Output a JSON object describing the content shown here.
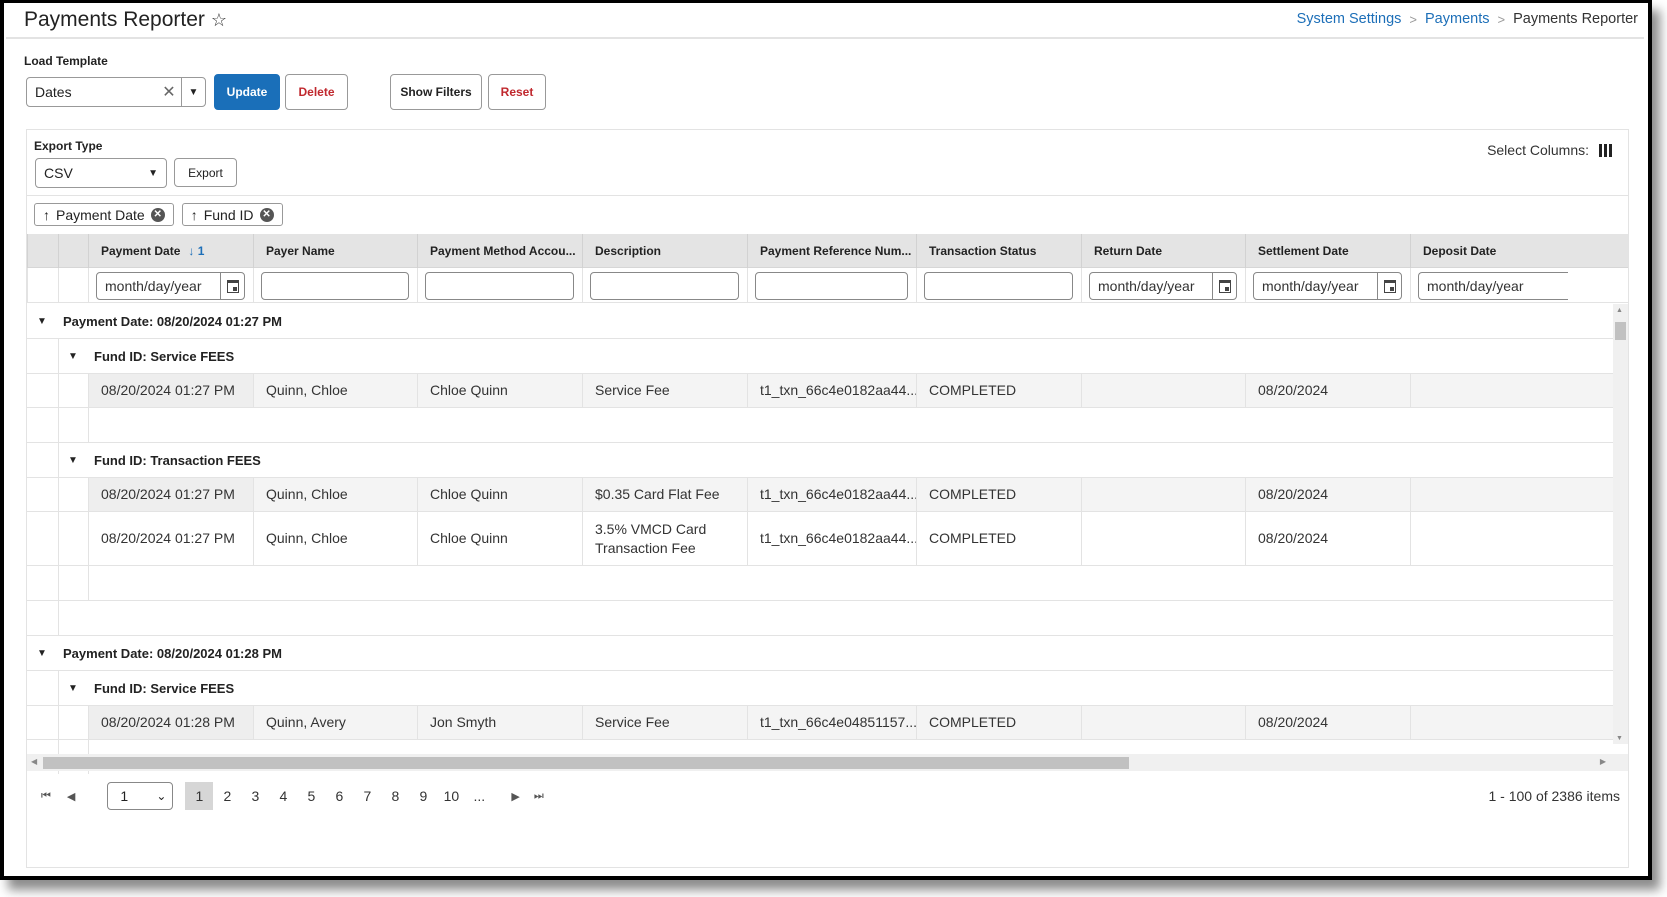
{
  "header": {
    "title": "Payments Reporter",
    "breadcrumb": [
      "System Settings",
      "Payments",
      "Payments Reporter"
    ]
  },
  "template": {
    "label": "Load Template",
    "value": "Dates",
    "update_label": "Update",
    "delete_label": "Delete",
    "show_filters_label": "Show Filters",
    "reset_label": "Reset"
  },
  "export": {
    "label": "Export Type",
    "value": "CSV",
    "button_label": "Export",
    "select_columns_label": "Select Columns:"
  },
  "group_chips": [
    "Payment Date",
    "Fund ID"
  ],
  "columns": [
    {
      "label": "Payment Date",
      "sort": "1",
      "filter": "month/day/year",
      "date": true
    },
    {
      "label": "Payer Name",
      "filter": ""
    },
    {
      "label": "Payment Method Accou...",
      "filter": ""
    },
    {
      "label": "Description",
      "filter": ""
    },
    {
      "label": "Payment Reference Num...",
      "filter": ""
    },
    {
      "label": "Transaction Status",
      "filter": ""
    },
    {
      "label": "Return Date",
      "filter": "month/day/year",
      "date": true
    },
    {
      "label": "Settlement Date",
      "filter": "month/day/year",
      "date": true
    },
    {
      "label": "Deposit Date",
      "filter": "month/day/year",
      "date": true
    }
  ],
  "groups": [
    {
      "label": "Payment Date: 08/20/2024 01:27 PM",
      "funds": [
        {
          "label": "Fund ID: Service FEES",
          "rows": [
            [
              "08/20/2024 01:27 PM",
              "Quinn, Chloe",
              "Chloe Quinn",
              "Service Fee",
              "t1_txn_66c4e0182aa44...",
              "COMPLETED",
              "",
              "08/20/2024",
              ""
            ]
          ]
        },
        {
          "label": "Fund ID: Transaction FEES",
          "rows": [
            [
              "08/20/2024 01:27 PM",
              "Quinn, Chloe",
              "Chloe Quinn",
              "$0.35 Card Flat Fee",
              "t1_txn_66c4e0182aa44...",
              "COMPLETED",
              "",
              "08/20/2024",
              ""
            ],
            [
              "08/20/2024 01:27 PM",
              "Quinn, Chloe",
              "Chloe Quinn",
              "3.5% VMCD Card Transaction Fee",
              "t1_txn_66c4e0182aa44...",
              "COMPLETED",
              "",
              "08/20/2024",
              ""
            ]
          ]
        }
      ]
    },
    {
      "label": "Payment Date: 08/20/2024 01:28 PM",
      "funds": [
        {
          "label": "Fund ID: Service FEES",
          "rows": [
            [
              "08/20/2024 01:28 PM",
              "Quinn, Avery",
              "Jon Smyth",
              "Service Fee",
              "t1_txn_66c4e04851157...",
              "COMPLETED",
              "",
              "08/20/2024",
              ""
            ]
          ]
        }
      ]
    }
  ],
  "pager": {
    "page_select": "1",
    "pages": [
      "1",
      "2",
      "3",
      "4",
      "5",
      "6",
      "7",
      "8",
      "9",
      "10",
      "..."
    ],
    "current_page": "1",
    "info": "1 - 100 of 2386 items"
  }
}
